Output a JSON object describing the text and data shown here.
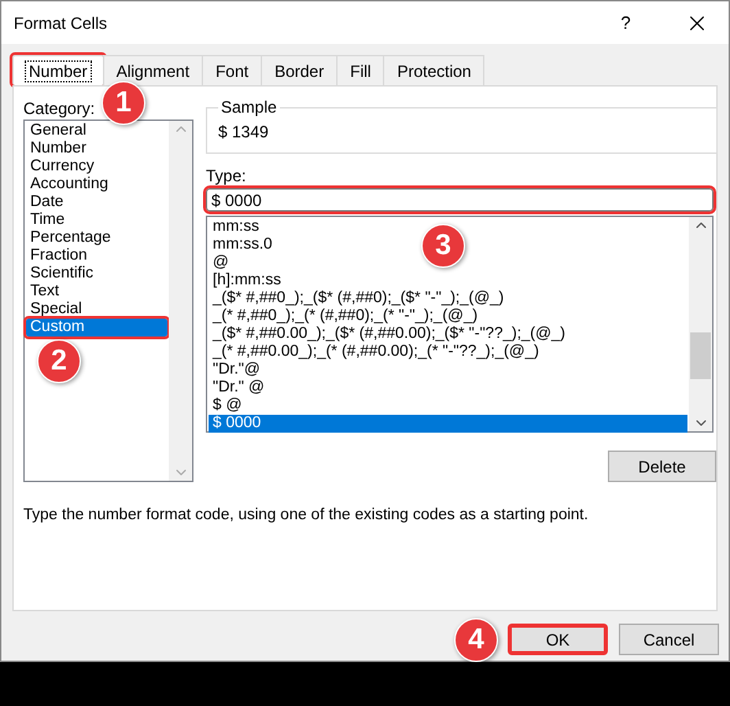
{
  "window": {
    "title": "Format Cells",
    "help": "?"
  },
  "tabs": [
    {
      "label": "Number",
      "selected": true,
      "highlighted": true
    },
    {
      "label": "Alignment",
      "selected": false,
      "highlighted": false
    },
    {
      "label": "Font",
      "selected": false,
      "highlighted": false
    },
    {
      "label": "Border",
      "selected": false,
      "highlighted": false
    },
    {
      "label": "Fill",
      "selected": false,
      "highlighted": false
    },
    {
      "label": "Protection",
      "selected": false,
      "highlighted": false
    }
  ],
  "category": {
    "label": "Category:",
    "items": [
      {
        "label": "General",
        "selected": false,
        "highlighted": false
      },
      {
        "label": "Number",
        "selected": false,
        "highlighted": false
      },
      {
        "label": "Currency",
        "selected": false,
        "highlighted": false
      },
      {
        "label": "Accounting",
        "selected": false,
        "highlighted": false
      },
      {
        "label": "Date",
        "selected": false,
        "highlighted": false
      },
      {
        "label": "Time",
        "selected": false,
        "highlighted": false
      },
      {
        "label": "Percentage",
        "selected": false,
        "highlighted": false
      },
      {
        "label": "Fraction",
        "selected": false,
        "highlighted": false
      },
      {
        "label": "Scientific",
        "selected": false,
        "highlighted": false
      },
      {
        "label": "Text",
        "selected": false,
        "highlighted": false
      },
      {
        "label": "Special",
        "selected": false,
        "highlighted": false
      },
      {
        "label": "Custom",
        "selected": true,
        "highlighted": true
      }
    ]
  },
  "sample": {
    "label": "Sample",
    "value": "$ 1349"
  },
  "type": {
    "label": "Type:",
    "value": "$ 0000",
    "highlighted": true
  },
  "formats": [
    {
      "label": "mm:ss",
      "selected": false
    },
    {
      "label": "mm:ss.0",
      "selected": false
    },
    {
      "label": "@",
      "selected": false
    },
    {
      "label": "[h]:mm:ss",
      "selected": false
    },
    {
      "label": "_($* #,##0_);_($* (#,##0);_($* \"-\"_);_(@_)",
      "selected": false
    },
    {
      "label": "_(* #,##0_);_(* (#,##0);_(* \"-\"_);_(@_)",
      "selected": false
    },
    {
      "label": "_($* #,##0.00_);_($* (#,##0.00);_($* \"-\"??_);_(@_)",
      "selected": false
    },
    {
      "label": "_(* #,##0.00_);_(* (#,##0.00);_(* \"-\"??_);_(@_)",
      "selected": false
    },
    {
      "label": "\"Dr.\"@",
      "selected": false
    },
    {
      "label": "\"Dr.\" @",
      "selected": false
    },
    {
      "label": "$ @",
      "selected": false
    },
    {
      "label": "$ 0000",
      "selected": true
    }
  ],
  "delete_button": "Delete",
  "description": "Type the number format code, using one of the existing codes as a starting point.",
  "buttons": [
    {
      "label": "OK",
      "highlighted": true
    },
    {
      "label": "Cancel",
      "highlighted": false
    }
  ],
  "annotations": [
    "1",
    "2",
    "3",
    "4"
  ]
}
